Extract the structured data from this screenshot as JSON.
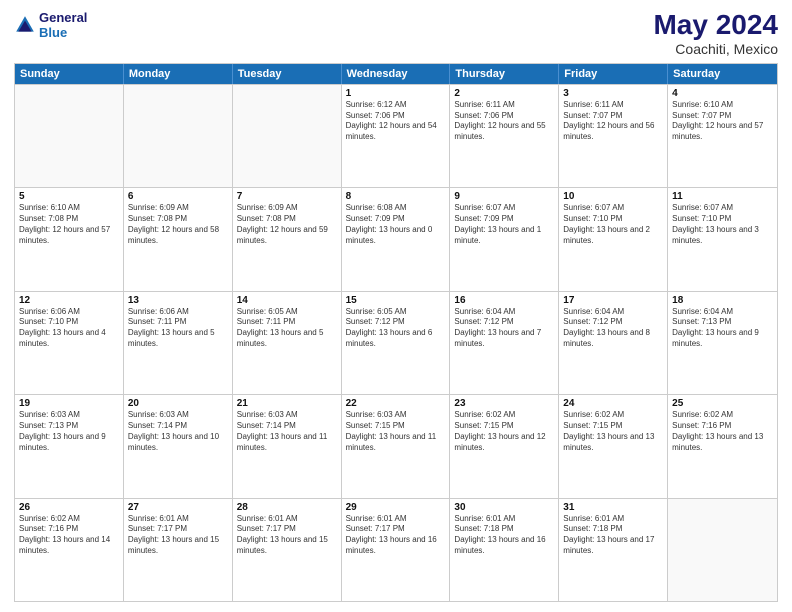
{
  "header": {
    "logo_line1": "General",
    "logo_line2": "Blue",
    "main_title": "May 2024",
    "subtitle": "Coachiti, Mexico"
  },
  "weekdays": [
    "Sunday",
    "Monday",
    "Tuesday",
    "Wednesday",
    "Thursday",
    "Friday",
    "Saturday"
  ],
  "weeks": [
    [
      {
        "day": "",
        "sunrise": "",
        "sunset": "",
        "daylight": ""
      },
      {
        "day": "",
        "sunrise": "",
        "sunset": "",
        "daylight": ""
      },
      {
        "day": "",
        "sunrise": "",
        "sunset": "",
        "daylight": ""
      },
      {
        "day": "1",
        "sunrise": "Sunrise: 6:12 AM",
        "sunset": "Sunset: 7:06 PM",
        "daylight": "Daylight: 12 hours and 54 minutes."
      },
      {
        "day": "2",
        "sunrise": "Sunrise: 6:11 AM",
        "sunset": "Sunset: 7:06 PM",
        "daylight": "Daylight: 12 hours and 55 minutes."
      },
      {
        "day": "3",
        "sunrise": "Sunrise: 6:11 AM",
        "sunset": "Sunset: 7:07 PM",
        "daylight": "Daylight: 12 hours and 56 minutes."
      },
      {
        "day": "4",
        "sunrise": "Sunrise: 6:10 AM",
        "sunset": "Sunset: 7:07 PM",
        "daylight": "Daylight: 12 hours and 57 minutes."
      }
    ],
    [
      {
        "day": "5",
        "sunrise": "Sunrise: 6:10 AM",
        "sunset": "Sunset: 7:08 PM",
        "daylight": "Daylight: 12 hours and 57 minutes."
      },
      {
        "day": "6",
        "sunrise": "Sunrise: 6:09 AM",
        "sunset": "Sunset: 7:08 PM",
        "daylight": "Daylight: 12 hours and 58 minutes."
      },
      {
        "day": "7",
        "sunrise": "Sunrise: 6:09 AM",
        "sunset": "Sunset: 7:08 PM",
        "daylight": "Daylight: 12 hours and 59 minutes."
      },
      {
        "day": "8",
        "sunrise": "Sunrise: 6:08 AM",
        "sunset": "Sunset: 7:09 PM",
        "daylight": "Daylight: 13 hours and 0 minutes."
      },
      {
        "day": "9",
        "sunrise": "Sunrise: 6:07 AM",
        "sunset": "Sunset: 7:09 PM",
        "daylight": "Daylight: 13 hours and 1 minute."
      },
      {
        "day": "10",
        "sunrise": "Sunrise: 6:07 AM",
        "sunset": "Sunset: 7:10 PM",
        "daylight": "Daylight: 13 hours and 2 minutes."
      },
      {
        "day": "11",
        "sunrise": "Sunrise: 6:07 AM",
        "sunset": "Sunset: 7:10 PM",
        "daylight": "Daylight: 13 hours and 3 minutes."
      }
    ],
    [
      {
        "day": "12",
        "sunrise": "Sunrise: 6:06 AM",
        "sunset": "Sunset: 7:10 PM",
        "daylight": "Daylight: 13 hours and 4 minutes."
      },
      {
        "day": "13",
        "sunrise": "Sunrise: 6:06 AM",
        "sunset": "Sunset: 7:11 PM",
        "daylight": "Daylight: 13 hours and 5 minutes."
      },
      {
        "day": "14",
        "sunrise": "Sunrise: 6:05 AM",
        "sunset": "Sunset: 7:11 PM",
        "daylight": "Daylight: 13 hours and 5 minutes."
      },
      {
        "day": "15",
        "sunrise": "Sunrise: 6:05 AM",
        "sunset": "Sunset: 7:12 PM",
        "daylight": "Daylight: 13 hours and 6 minutes."
      },
      {
        "day": "16",
        "sunrise": "Sunrise: 6:04 AM",
        "sunset": "Sunset: 7:12 PM",
        "daylight": "Daylight: 13 hours and 7 minutes."
      },
      {
        "day": "17",
        "sunrise": "Sunrise: 6:04 AM",
        "sunset": "Sunset: 7:12 PM",
        "daylight": "Daylight: 13 hours and 8 minutes."
      },
      {
        "day": "18",
        "sunrise": "Sunrise: 6:04 AM",
        "sunset": "Sunset: 7:13 PM",
        "daylight": "Daylight: 13 hours and 9 minutes."
      }
    ],
    [
      {
        "day": "19",
        "sunrise": "Sunrise: 6:03 AM",
        "sunset": "Sunset: 7:13 PM",
        "daylight": "Daylight: 13 hours and 9 minutes."
      },
      {
        "day": "20",
        "sunrise": "Sunrise: 6:03 AM",
        "sunset": "Sunset: 7:14 PM",
        "daylight": "Daylight: 13 hours and 10 minutes."
      },
      {
        "day": "21",
        "sunrise": "Sunrise: 6:03 AM",
        "sunset": "Sunset: 7:14 PM",
        "daylight": "Daylight: 13 hours and 11 minutes."
      },
      {
        "day": "22",
        "sunrise": "Sunrise: 6:03 AM",
        "sunset": "Sunset: 7:15 PM",
        "daylight": "Daylight: 13 hours and 11 minutes."
      },
      {
        "day": "23",
        "sunrise": "Sunrise: 6:02 AM",
        "sunset": "Sunset: 7:15 PM",
        "daylight": "Daylight: 13 hours and 12 minutes."
      },
      {
        "day": "24",
        "sunrise": "Sunrise: 6:02 AM",
        "sunset": "Sunset: 7:15 PM",
        "daylight": "Daylight: 13 hours and 13 minutes."
      },
      {
        "day": "25",
        "sunrise": "Sunrise: 6:02 AM",
        "sunset": "Sunset: 7:16 PM",
        "daylight": "Daylight: 13 hours and 13 minutes."
      }
    ],
    [
      {
        "day": "26",
        "sunrise": "Sunrise: 6:02 AM",
        "sunset": "Sunset: 7:16 PM",
        "daylight": "Daylight: 13 hours and 14 minutes."
      },
      {
        "day": "27",
        "sunrise": "Sunrise: 6:01 AM",
        "sunset": "Sunset: 7:17 PM",
        "daylight": "Daylight: 13 hours and 15 minutes."
      },
      {
        "day": "28",
        "sunrise": "Sunrise: 6:01 AM",
        "sunset": "Sunset: 7:17 PM",
        "daylight": "Daylight: 13 hours and 15 minutes."
      },
      {
        "day": "29",
        "sunrise": "Sunrise: 6:01 AM",
        "sunset": "Sunset: 7:17 PM",
        "daylight": "Daylight: 13 hours and 16 minutes."
      },
      {
        "day": "30",
        "sunrise": "Sunrise: 6:01 AM",
        "sunset": "Sunset: 7:18 PM",
        "daylight": "Daylight: 13 hours and 16 minutes."
      },
      {
        "day": "31",
        "sunrise": "Sunrise: 6:01 AM",
        "sunset": "Sunset: 7:18 PM",
        "daylight": "Daylight: 13 hours and 17 minutes."
      },
      {
        "day": "",
        "sunrise": "",
        "sunset": "",
        "daylight": ""
      }
    ]
  ]
}
